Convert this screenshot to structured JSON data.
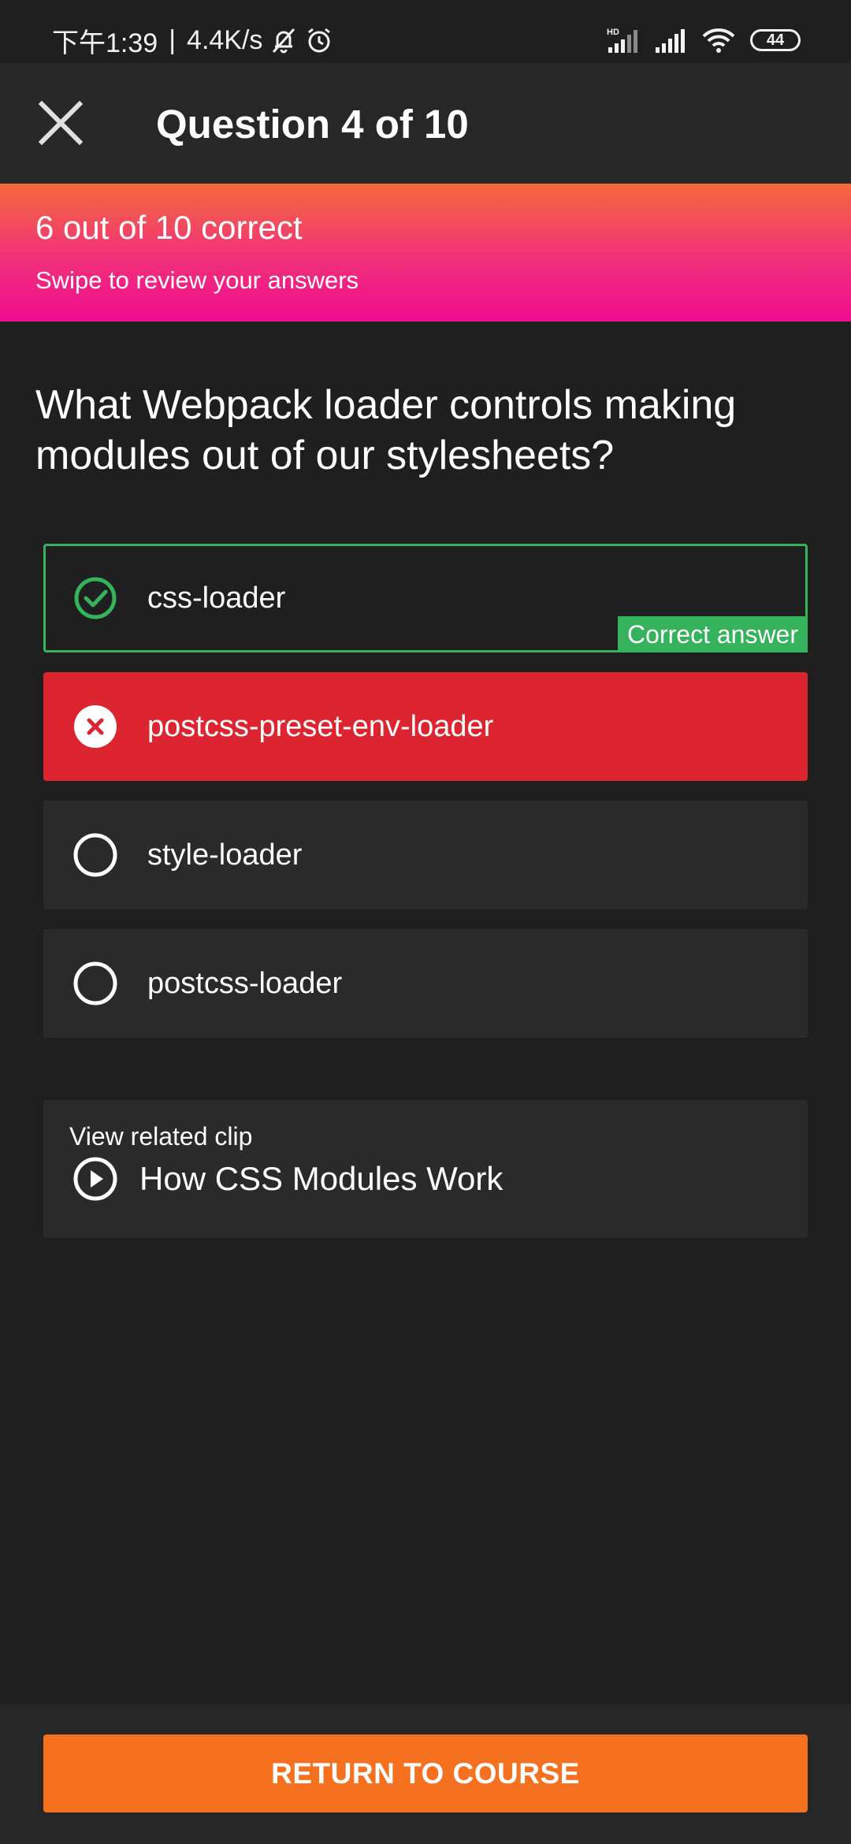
{
  "status_bar": {
    "time": "下午1:39",
    "separator": "|",
    "network_speed": "4.4K/s",
    "battery": "44",
    "icons": [
      "bell-muted-icon",
      "alarm-icon",
      "hd-signal-icon",
      "signal-icon",
      "wifi-icon",
      "battery-icon"
    ]
  },
  "header": {
    "title": "Question 4 of 10",
    "close_icon": "close-icon"
  },
  "score": {
    "text": "6 out of 10 correct",
    "hint": "Swipe to review your answers",
    "gradient": [
      "#f36a3c",
      "#ee0c8f"
    ]
  },
  "question": {
    "text": "What Webpack loader controls making modules out of our stylesheets?"
  },
  "answers": [
    {
      "label": "css-loader",
      "state": "correct",
      "tag": "Correct answer",
      "icon": "check-circle-icon"
    },
    {
      "label": "postcss-preset-env-loader",
      "state": "wrong-selected",
      "icon": "x-circle-icon"
    },
    {
      "label": "style-loader",
      "state": "unselected",
      "icon": "radio-empty-icon"
    },
    {
      "label": "postcss-loader",
      "state": "unselected",
      "icon": "radio-empty-icon"
    }
  ],
  "related_clip": {
    "caption": "View related clip",
    "title": "How CSS Modules Work",
    "icon": "play-circle-icon"
  },
  "footer": {
    "button_label": "RETURN TO COURSE"
  },
  "colors": {
    "background": "#1f1f1f",
    "bar": "#272727",
    "correct": "#34b25c",
    "wrong": "#dd2532",
    "accent": "#f5701f"
  }
}
